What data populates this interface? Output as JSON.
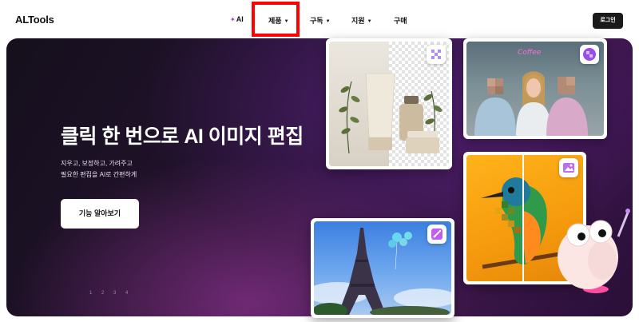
{
  "header": {
    "logo": "ALTools",
    "nav": {
      "ai_label": "AI",
      "products_label": "제품",
      "subscribe_label": "구독",
      "support_label": "지원",
      "buy_label": "구매"
    },
    "login_label": "로그인"
  },
  "hero": {
    "title": "클릭 한 번으로 AI 이미지 편집",
    "subtitle_line1": "지우고, 보정하고, 가려주고",
    "subtitle_line2": "필요한 편집을 AI로 간편하게",
    "cta_label": "기능 알아보기",
    "pager": "1 2 3 4"
  },
  "icons": [
    "sparkle-icon",
    "caret-down-icon",
    "checker-eraser-icon",
    "blur-face-icon",
    "image-enhance-icon",
    "magic-wand-icon"
  ],
  "colors": {
    "accent": "#8a3df0",
    "highlight": "#ff0000",
    "login_bg": "#1a1a1a"
  }
}
